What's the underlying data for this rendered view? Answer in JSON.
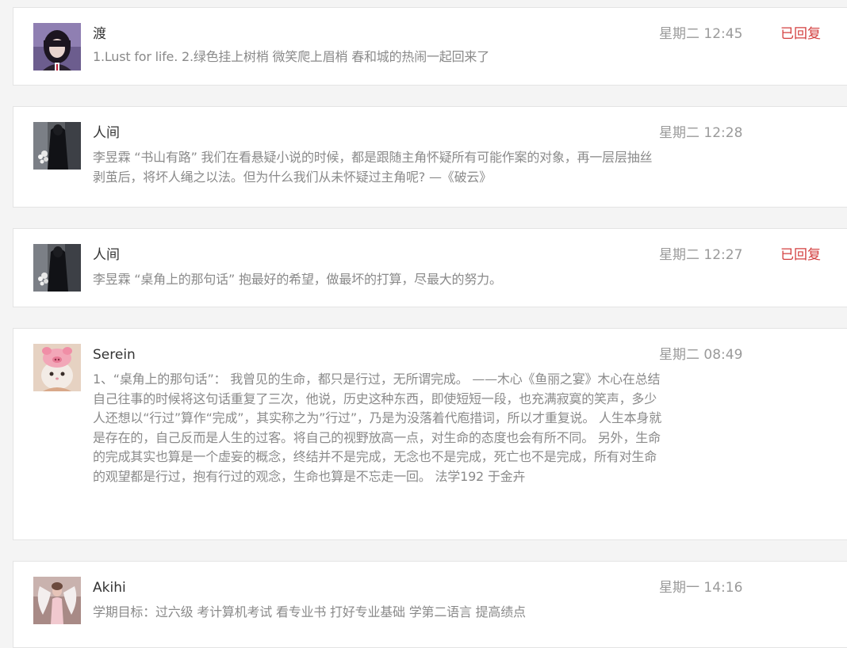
{
  "messages": [
    {
      "sender": "渡",
      "preview": "1.Lust for life. 2.绿色挂上树梢 微笑爬上眉梢 春和城的热闹一起回来了",
      "time": "星期二 12:45",
      "status": "已回复",
      "avatar_icon": "girl-portrait-avatar"
    },
    {
      "sender": "人间",
      "preview": "李昱霖 “书山有路” 我们在看悬疑小说的时候，都是跟随主角怀疑所有可能作案的对象，再一层层抽丝剥茧后，将坏人绳之以法。但为什么我们从未怀疑过主角呢? —《破云》",
      "time": "星期二 12:28",
      "status": "",
      "avatar_icon": "person-with-flowers-avatar"
    },
    {
      "sender": "人间",
      "preview": "李昱霖 “桌角上的那句话” 抱最好的希望，做最坏的打算，尽最大的努力。",
      "time": "星期二 12:27",
      "status": "已回复",
      "avatar_icon": "person-with-flowers-avatar"
    },
    {
      "sender": "Serein",
      "preview": "1、“桌角上的那句话”： 我曾见的生命，都只是行过，无所谓完成。 ——木心《鱼丽之宴》木心在总结自己往事的时候将这句话重复了三次，他说，历史这种东西，即使短短一段，也充满寂寞的笑声，多少人还想以“行过”算作“完成”，其实称之为”行过”，乃是为没落着代庖措词，所以才重复说。 人生本身就是存在的，自己反而是人生的过客。将自己的视野放高一点，对生命的态度也会有所不同。 另外，生命的完成其实也算是一个虚妄的概念，终结并不是完成，无念也不是完成，死亡也不是完成，所有对生命的观望都是行过，抱有行过的观念，生命也算是不忘走一回。 法学192 于金卉",
      "time": "星期二 08:49",
      "status": "",
      "avatar_icon": "cat-pig-hat-avatar"
    },
    {
      "sender": "Akihi",
      "preview": "学期目标：过六级 考计算机考试 看专业书 打好专业基础 学第二语言 提高绩点",
      "time": "星期一 14:16",
      "status": "",
      "avatar_icon": "angel-wings-avatar"
    }
  ]
}
